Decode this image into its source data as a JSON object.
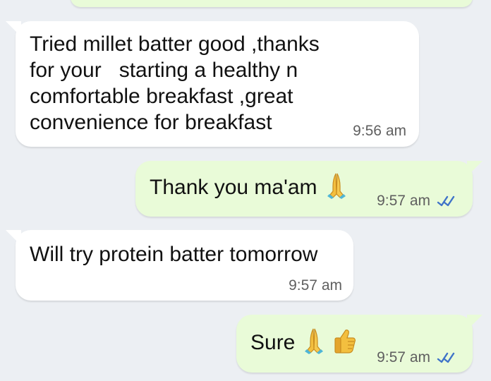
{
  "messages": [
    {
      "direction": "outgoing",
      "text": "",
      "time": ""
    },
    {
      "direction": "incoming",
      "text": "Tried millet batter good ,thanks\nfor your   starting a healthy n\ncomfortable breakfast ,great\nconvenience for breakfast",
      "time": "9:56 am"
    },
    {
      "direction": "outgoing",
      "text": "Thank you ma'am",
      "time": "9:57 am",
      "emoji": "folded-hands"
    },
    {
      "direction": "incoming",
      "text": "Will try protein batter tomorrow",
      "time": "9:57 am"
    },
    {
      "direction": "outgoing",
      "text": "Sure",
      "time": "9:57 am",
      "emoji_1": "folded-hands",
      "emoji_2": "thumbs-up"
    }
  ],
  "colors": {
    "background": "#eceff3",
    "incoming_bubble": "#ffffff",
    "outgoing_bubble": "#e9fbd8",
    "read_tick": "#3f73c8"
  }
}
